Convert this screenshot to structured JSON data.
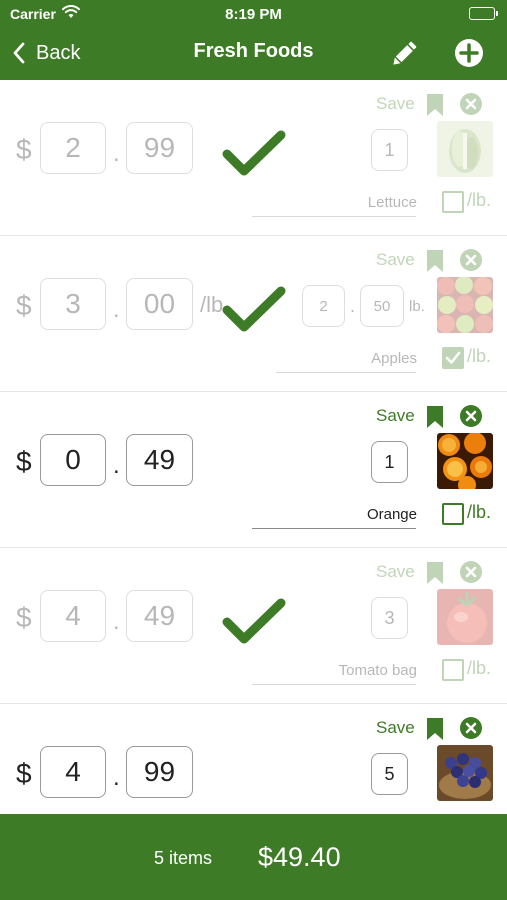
{
  "status": {
    "carrier": "Carrier",
    "time": "8:19 PM"
  },
  "nav": {
    "back_label": "Back",
    "title": "Fresh Foods"
  },
  "currency": "$",
  "decimal": ".",
  "per_lb_label": "/lb",
  "lb_unit_label": "lb.",
  "lb_checkbox_label": "/lb.",
  "save_label": "Save",
  "items": [
    {
      "name": "Lettuce",
      "dollars": "2",
      "cents": "99",
      "qty": "1",
      "priced_per_lb": false,
      "purchased": true,
      "image": "lettuce"
    },
    {
      "name": "Apples",
      "dollars": "3",
      "cents": "00",
      "weight_int": "2",
      "weight_dec": "50",
      "priced_per_lb": true,
      "purchased": true,
      "image": "apples"
    },
    {
      "name": "Orange",
      "dollars": "0",
      "cents": "49",
      "qty": "1",
      "priced_per_lb": false,
      "purchased": false,
      "image": "oranges"
    },
    {
      "name": "Tomato bag",
      "dollars": "4",
      "cents": "49",
      "qty": "3",
      "priced_per_lb": false,
      "purchased": true,
      "image": "tomatoes"
    },
    {
      "name": "",
      "dollars": "4",
      "cents": "99",
      "qty": "5",
      "priced_per_lb": false,
      "purchased": false,
      "image": "grapes"
    }
  ],
  "footer": {
    "count": "5 items",
    "total": "$49.40"
  },
  "colors": {
    "brand_green": "#3e7b27",
    "text": "#222222",
    "border": "#9a9a9a"
  }
}
